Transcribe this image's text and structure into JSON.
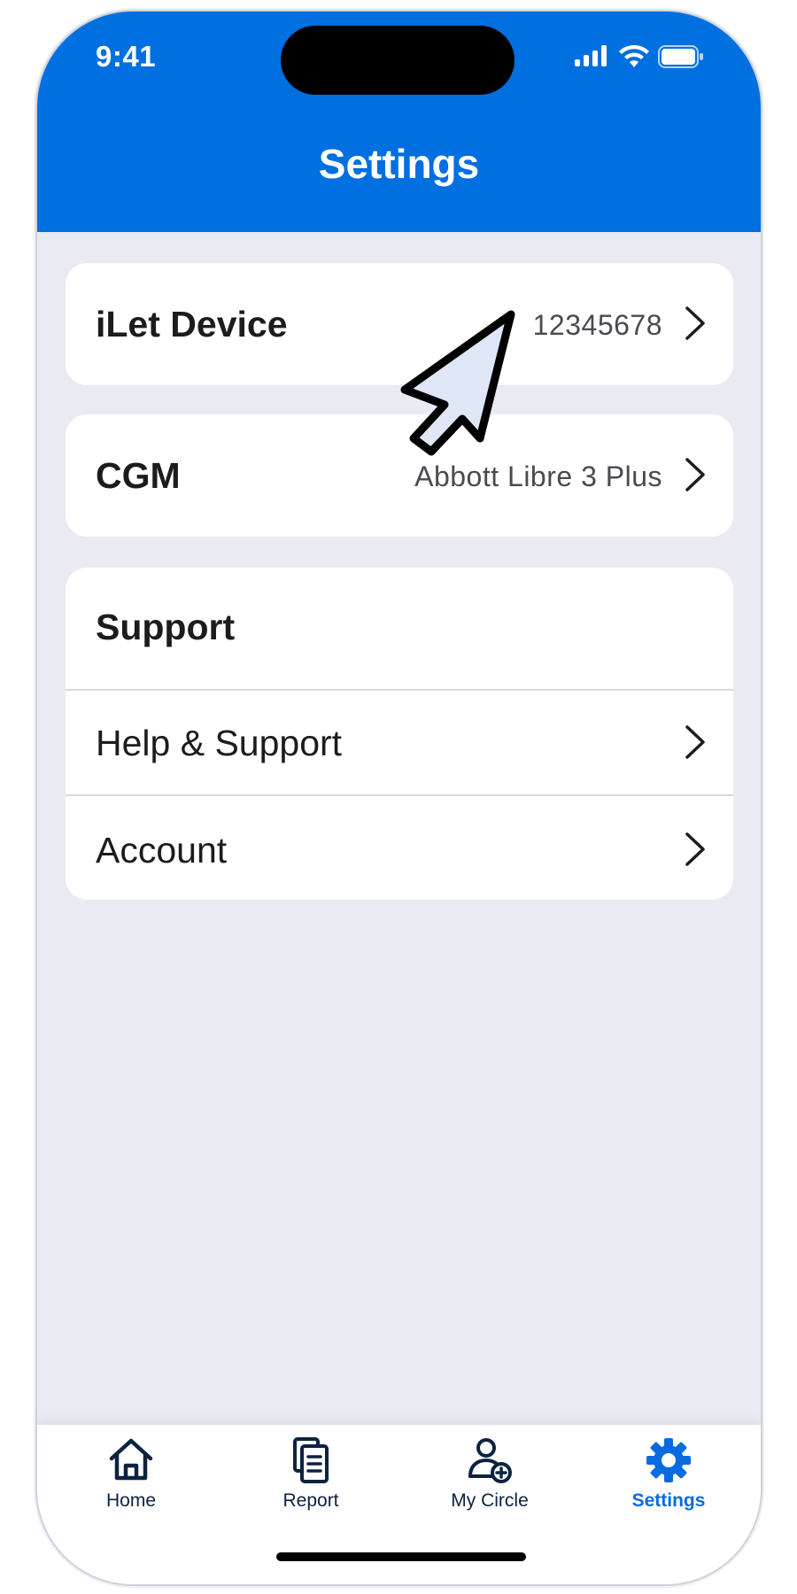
{
  "status_bar": {
    "time": "9:41"
  },
  "header": {
    "title": "Settings"
  },
  "device_card": {
    "label": "iLet Device",
    "value": "12345678"
  },
  "cgm_card": {
    "label": "CGM",
    "value": "Abbott Libre 3 Plus"
  },
  "support_card": {
    "heading": "Support",
    "items": [
      {
        "label": "Help & Support"
      },
      {
        "label": "Account"
      }
    ]
  },
  "tab_bar": {
    "tabs": [
      {
        "label": "Home",
        "icon": "home-icon"
      },
      {
        "label": "Report",
        "icon": "report-icon"
      },
      {
        "label": "My Circle",
        "icon": "add-person-icon"
      },
      {
        "label": "Settings",
        "icon": "gear-icon",
        "active": true
      }
    ]
  },
  "colors": {
    "header_blue": "#006fe0",
    "active_tab": "#0a6be0",
    "background": "#e9eaf2"
  }
}
